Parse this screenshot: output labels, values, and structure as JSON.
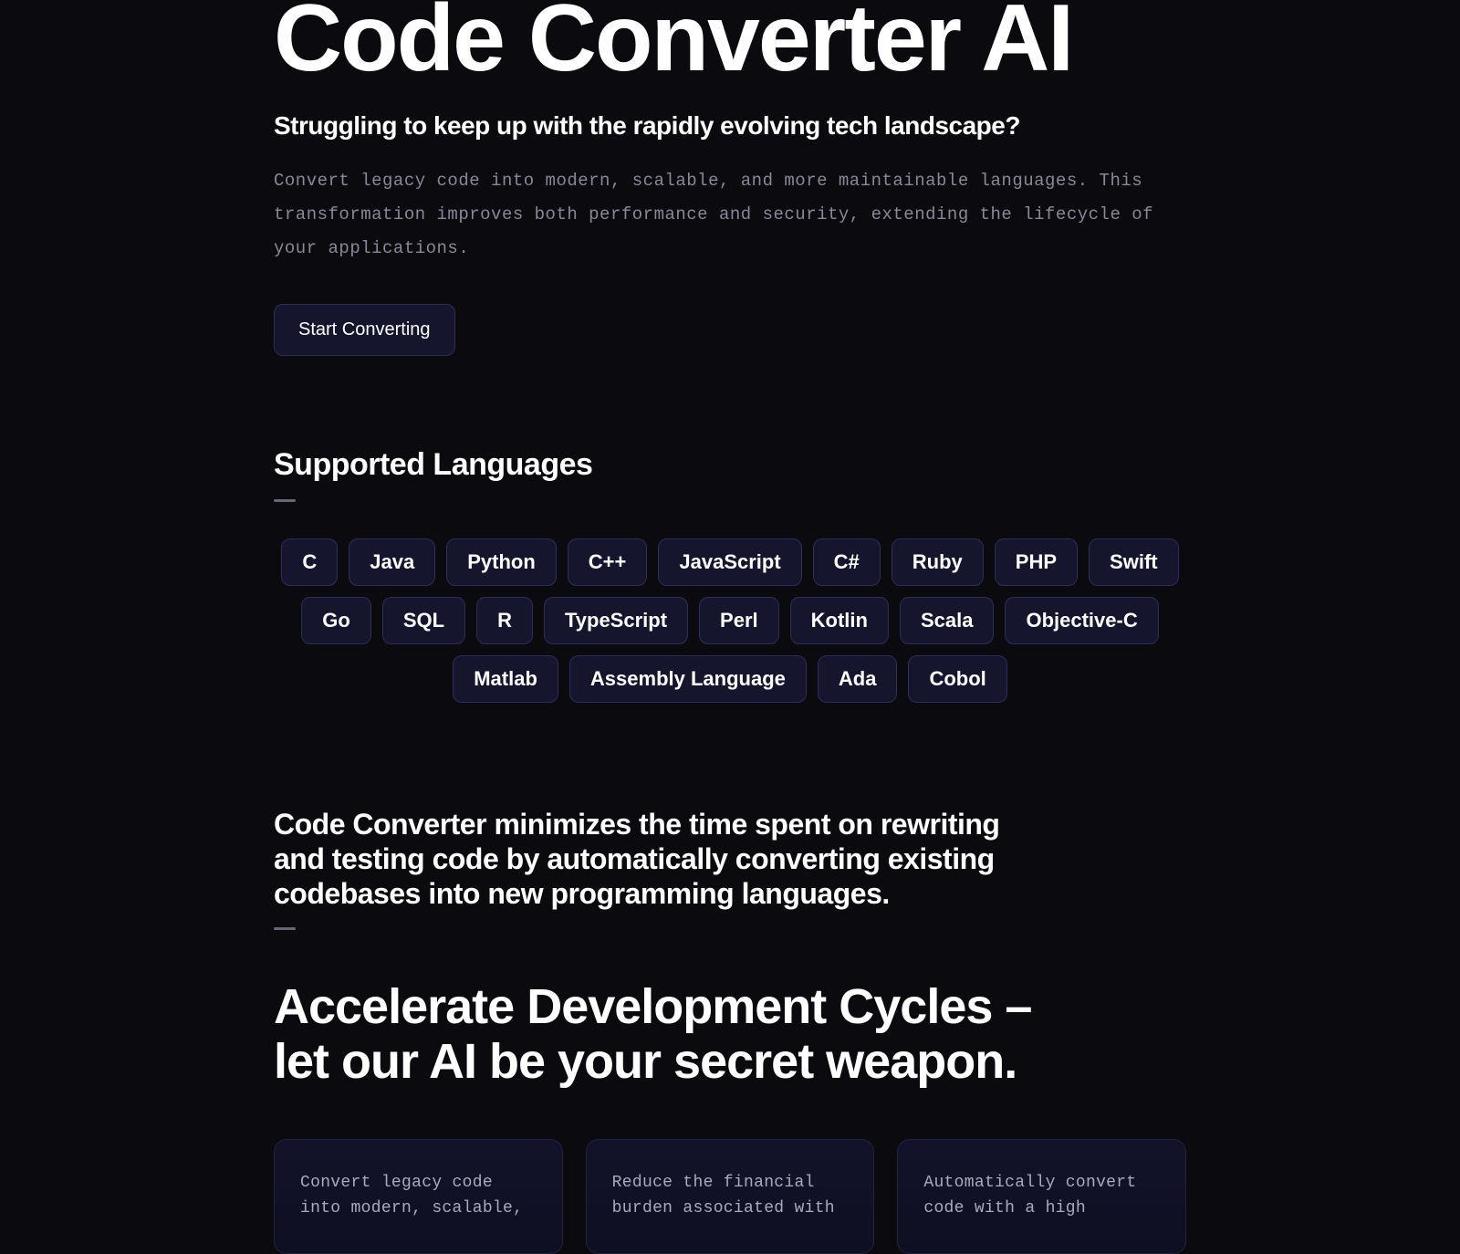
{
  "hero": {
    "title": "Code Converter AI",
    "subtitle": "Struggling to keep up with the rapidly evolving tech landscape?",
    "description": "Convert legacy code into modern, scalable, and more maintainable languages. This transformation improves both performance and security, extending the lifecycle of your applications.",
    "cta_label": "Start Converting"
  },
  "languages": {
    "heading": "Supported Languages",
    "items": [
      "C",
      "Java",
      "Python",
      "C++",
      "JavaScript",
      "C#",
      "Ruby",
      "PHP",
      "Swift",
      "Go",
      "SQL",
      "R",
      "TypeScript",
      "Perl",
      "Kotlin",
      "Scala",
      "Objective-C",
      "Matlab",
      "Assembly Language",
      "Ada",
      "Cobol"
    ]
  },
  "benefits": {
    "intro": "Code Converter minimizes the time spent on rewriting and testing code by automatically converting existing codebases into new programming languages.",
    "headline_line1": "Accelerate Development Cycles –",
    "headline_line2": "let our AI be your secret weapon.",
    "cards": [
      "Convert legacy code into modern, scalable,",
      "Reduce the financial burden associated with",
      "Automatically convert code with a high"
    ]
  }
}
